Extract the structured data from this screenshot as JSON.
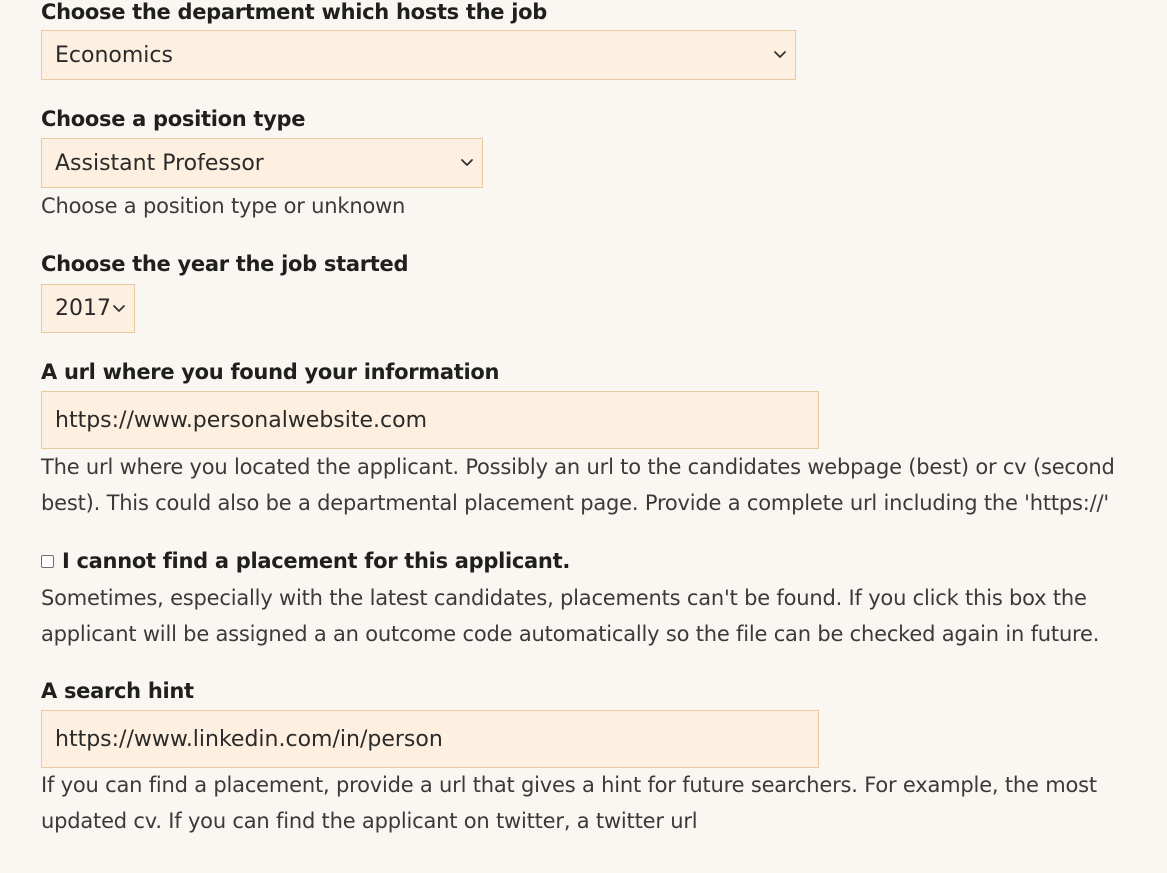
{
  "department": {
    "label": "Choose the department which hosts the job",
    "selected": "Economics"
  },
  "position_type": {
    "label": "Choose a position type",
    "selected": "Assistant Professor",
    "help": "Choose a position type or unknown"
  },
  "year_started": {
    "label": "Choose the year the job started",
    "selected": "2017"
  },
  "info_url": {
    "label": "A url where you found your information",
    "value": "https://www.personalwebsite.com",
    "help_line1": "The url where you located the applicant. Possibly an url to the candidates webpage (best) or cv (second",
    "help_line2": "best). This could also be a departmental placement page. Provide a complete url including the 'https://'"
  },
  "no_placement": {
    "label": "I cannot find a placement for this applicant.",
    "checked": false,
    "help_line1": "Sometimes, especially with the latest candidates, placements can't be found. If you click this box the",
    "help_line2": "applicant will be assigned a an outcome code automatically so the file can be checked again in future."
  },
  "search_hint": {
    "label": "A search hint",
    "value": "https://www.linkedin.com/in/person",
    "help_line1": "If you can find a placement, provide a url that gives a hint for future searchers. For example, the most",
    "help_line2": "updated cv. If you can find the applicant on twitter, a twitter url"
  },
  "icons": {
    "select_chevron": "chevron-down-icon",
    "checkbox": "checkbox-icon"
  }
}
